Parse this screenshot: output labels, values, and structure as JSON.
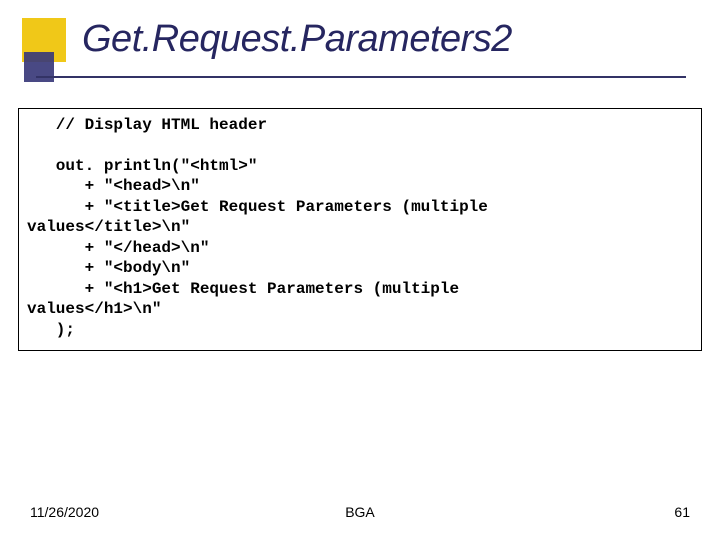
{
  "title": "Get.Request.Parameters2",
  "code": "   // Display HTML header\n\n   out. println(\"<html>\"\n      + \"<head>\\n\"\n      + \"<title>Get Request Parameters (multiple\nvalues</title>\\n\"\n      + \"</head>\\n\"\n      + \"<body\\n\"\n      + \"<h1>Get Request Parameters (multiple\nvalues</h1>\\n\"\n   );",
  "footer": {
    "date": "11/26/2020",
    "center": "BGA",
    "page": "61"
  }
}
